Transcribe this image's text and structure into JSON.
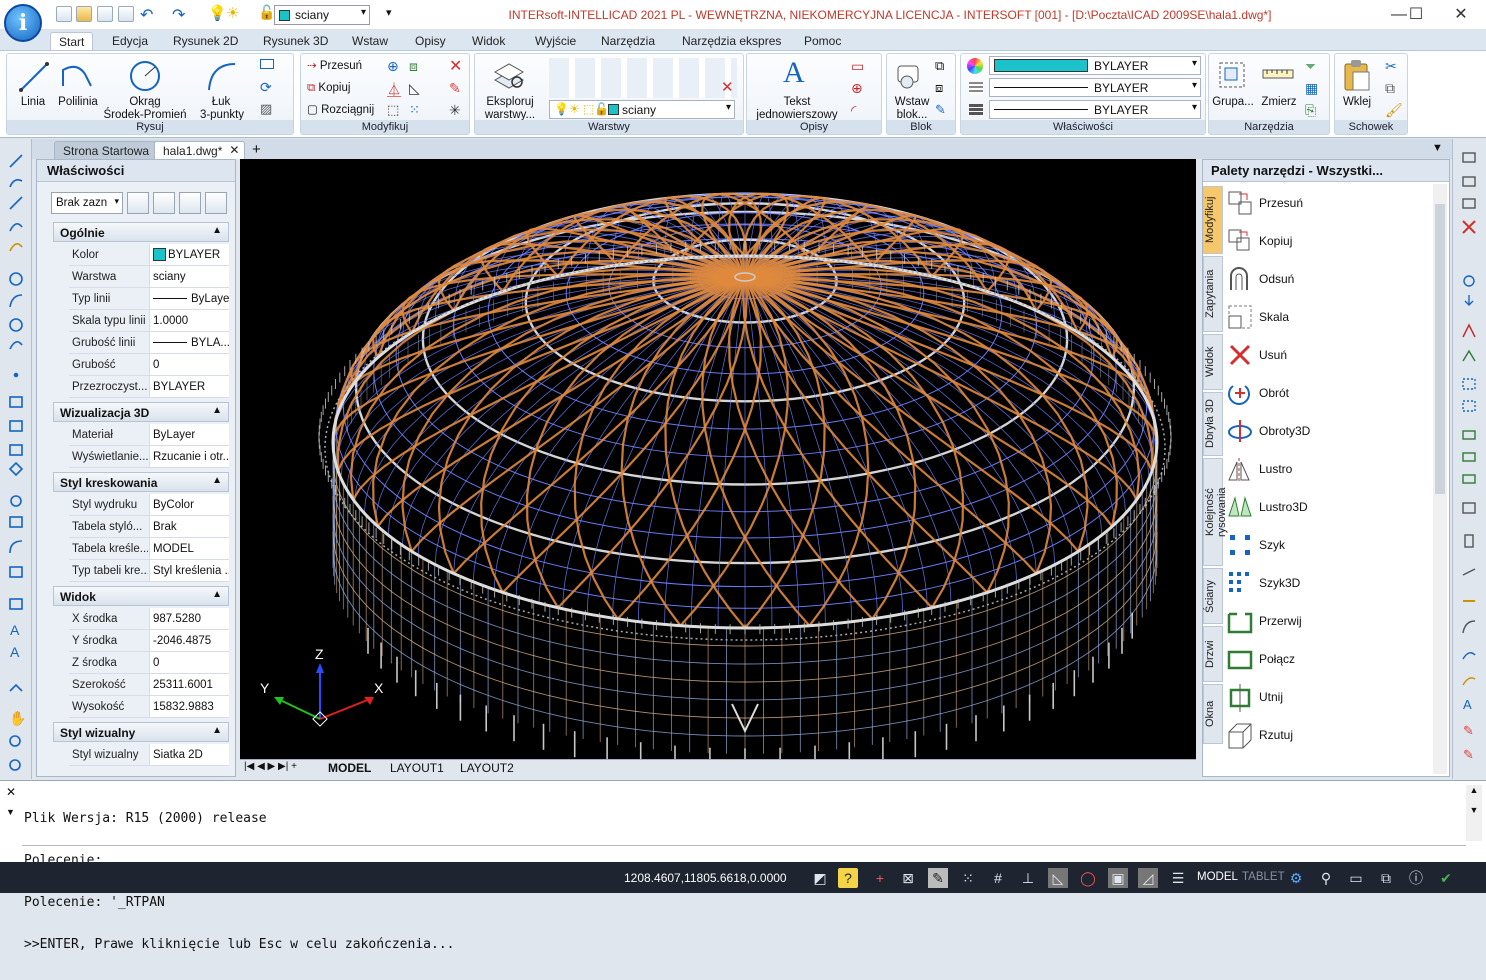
{
  "title_bar": {
    "layer_combo": "sciany",
    "title": "INTERsoft-INTELLICAD 2021 PL - WEWNĘTRZNA, NIEKOMERCYJNA LICENCJA - INTERSOFT [001] - [D:\\Poczta\\ICAD 2009SE\\hala1.dwg*]"
  },
  "ribbon": {
    "tabs": [
      "Start",
      "Edycja",
      "Rysunek 2D",
      "Rysunek 3D",
      "Wstaw",
      "Opisy",
      "Widok",
      "Wyjście",
      "Narzędzia",
      "Narzędzia ekspres",
      "Pomoc"
    ],
    "rysuj": {
      "linia": "Linia",
      "polilinia": "Polilinia",
      "okrag": "Okrąg",
      "okrag2": "Środek-Promień",
      "luk": "Łuk",
      "luk2": "3-punkty",
      "title": "Rysuj"
    },
    "modyfikuj": {
      "przesun": "Przesuń",
      "kopiuj": "Kopiuj",
      "rozciagnij": "Rozciągnij",
      "title": "Modyfikuj"
    },
    "warstwy": {
      "eksploruj": "Eksploruj",
      "eksploruj2": "warstwy...",
      "combo": "sciany",
      "title": "Warstwy"
    },
    "opisy": {
      "tekst": "Tekst",
      "tekst2": "jednowierszowy",
      "title": "Opisy"
    },
    "blok": {
      "wstaw": "Wstaw",
      "wstaw2": "blok...",
      "title": "Blok"
    },
    "wlasciwosci": {
      "color": "BYLAYER",
      "linetype": "BYLAYER",
      "lineweight": "BYLAYER",
      "title": "Właściwości"
    },
    "narzedzia": {
      "grupa": "Grupa...",
      "zmierz": "Zmierz",
      "title": "Narzędzia"
    },
    "schowek": {
      "wklej": "Wklej",
      "title": "Schowek"
    }
  },
  "doc_tabs": [
    "Strona Startowa",
    "hala1.dwg*"
  ],
  "properties": {
    "title": "Właściwości",
    "selection": "Brak zazn",
    "sections": [
      {
        "title": "Ogólnie",
        "rows": [
          [
            "Kolor",
            "BYLAYER"
          ],
          [
            "Warstwa",
            "sciany"
          ],
          [
            "Typ linii",
            "ByLayer"
          ],
          [
            "Skala typu linii",
            "1.0000"
          ],
          [
            "Grubość linii",
            "BYLA..."
          ],
          [
            "Grubość",
            "0"
          ],
          [
            "Przezroczyst...",
            "BYLAYER"
          ]
        ]
      },
      {
        "title": "Wizualizacja 3D",
        "rows": [
          [
            "Materiał",
            "ByLayer"
          ],
          [
            "Wyświetlanie...",
            "Rzucanie i otr..."
          ]
        ]
      },
      {
        "title": "Styl kreskowania",
        "rows": [
          [
            "Styl wydruku",
            "ByColor"
          ],
          [
            "Tabela styló...",
            "Brak"
          ],
          [
            "Tabela kreśle...",
            "MODEL"
          ],
          [
            "Typ tabeli kre...",
            "Styl kreślenia ..."
          ]
        ]
      },
      {
        "title": "Widok",
        "rows": [
          [
            "X środka",
            "987.5280"
          ],
          [
            "Y środka",
            "-2046.4875"
          ],
          [
            "Z środka",
            "0"
          ],
          [
            "Szerokość",
            "25311.6001"
          ],
          [
            "Wysokość",
            "15832.9883"
          ]
        ]
      },
      {
        "title": "Styl wizualny",
        "rows": [
          [
            "Styl wizualny",
            "Siatka 2D"
          ]
        ]
      }
    ]
  },
  "viewport": {
    "axis_x": "X",
    "axis_y": "Y",
    "axis_z": "Z"
  },
  "layout_tabs": [
    "MODEL",
    "LAYOUT1",
    "LAYOUT2"
  ],
  "palette": {
    "title": "Palety narzędzi - Wszystki...",
    "vertical_tabs": [
      "Modyfikuj",
      "Zapytania",
      "Widok",
      "Dbryła 3D",
      "Kolejność rysowania",
      "Ściany",
      "Drzwi",
      "Okna"
    ],
    "tools": [
      "Przesuń",
      "Kopiuj",
      "Odsuń",
      "Skala",
      "Usuń",
      "Obrót",
      "Obroty3D",
      "Lustro",
      "Lustro3D",
      "Szyk",
      "Szyk3D",
      "Przerwij",
      "Połącz",
      "Utnij",
      "Rzutuj"
    ]
  },
  "command_line": {
    "lines": [
      "Plik Wersja: R15 (2000) release",
      "Polecenie:",
      "Polecenie: '_RTPAN",
      ">>ENTER, Prawe kliknięcie lub Esc w celu zakończenia..."
    ]
  },
  "status_bar": {
    "coords": "1208.4607,11805.6618,0.0000",
    "model": "MODEL",
    "tablet": "TABLET"
  },
  "colors": {
    "accent": "#f6c86b",
    "layer": "#19c3c9",
    "orange_rib": "#e08a3c"
  }
}
